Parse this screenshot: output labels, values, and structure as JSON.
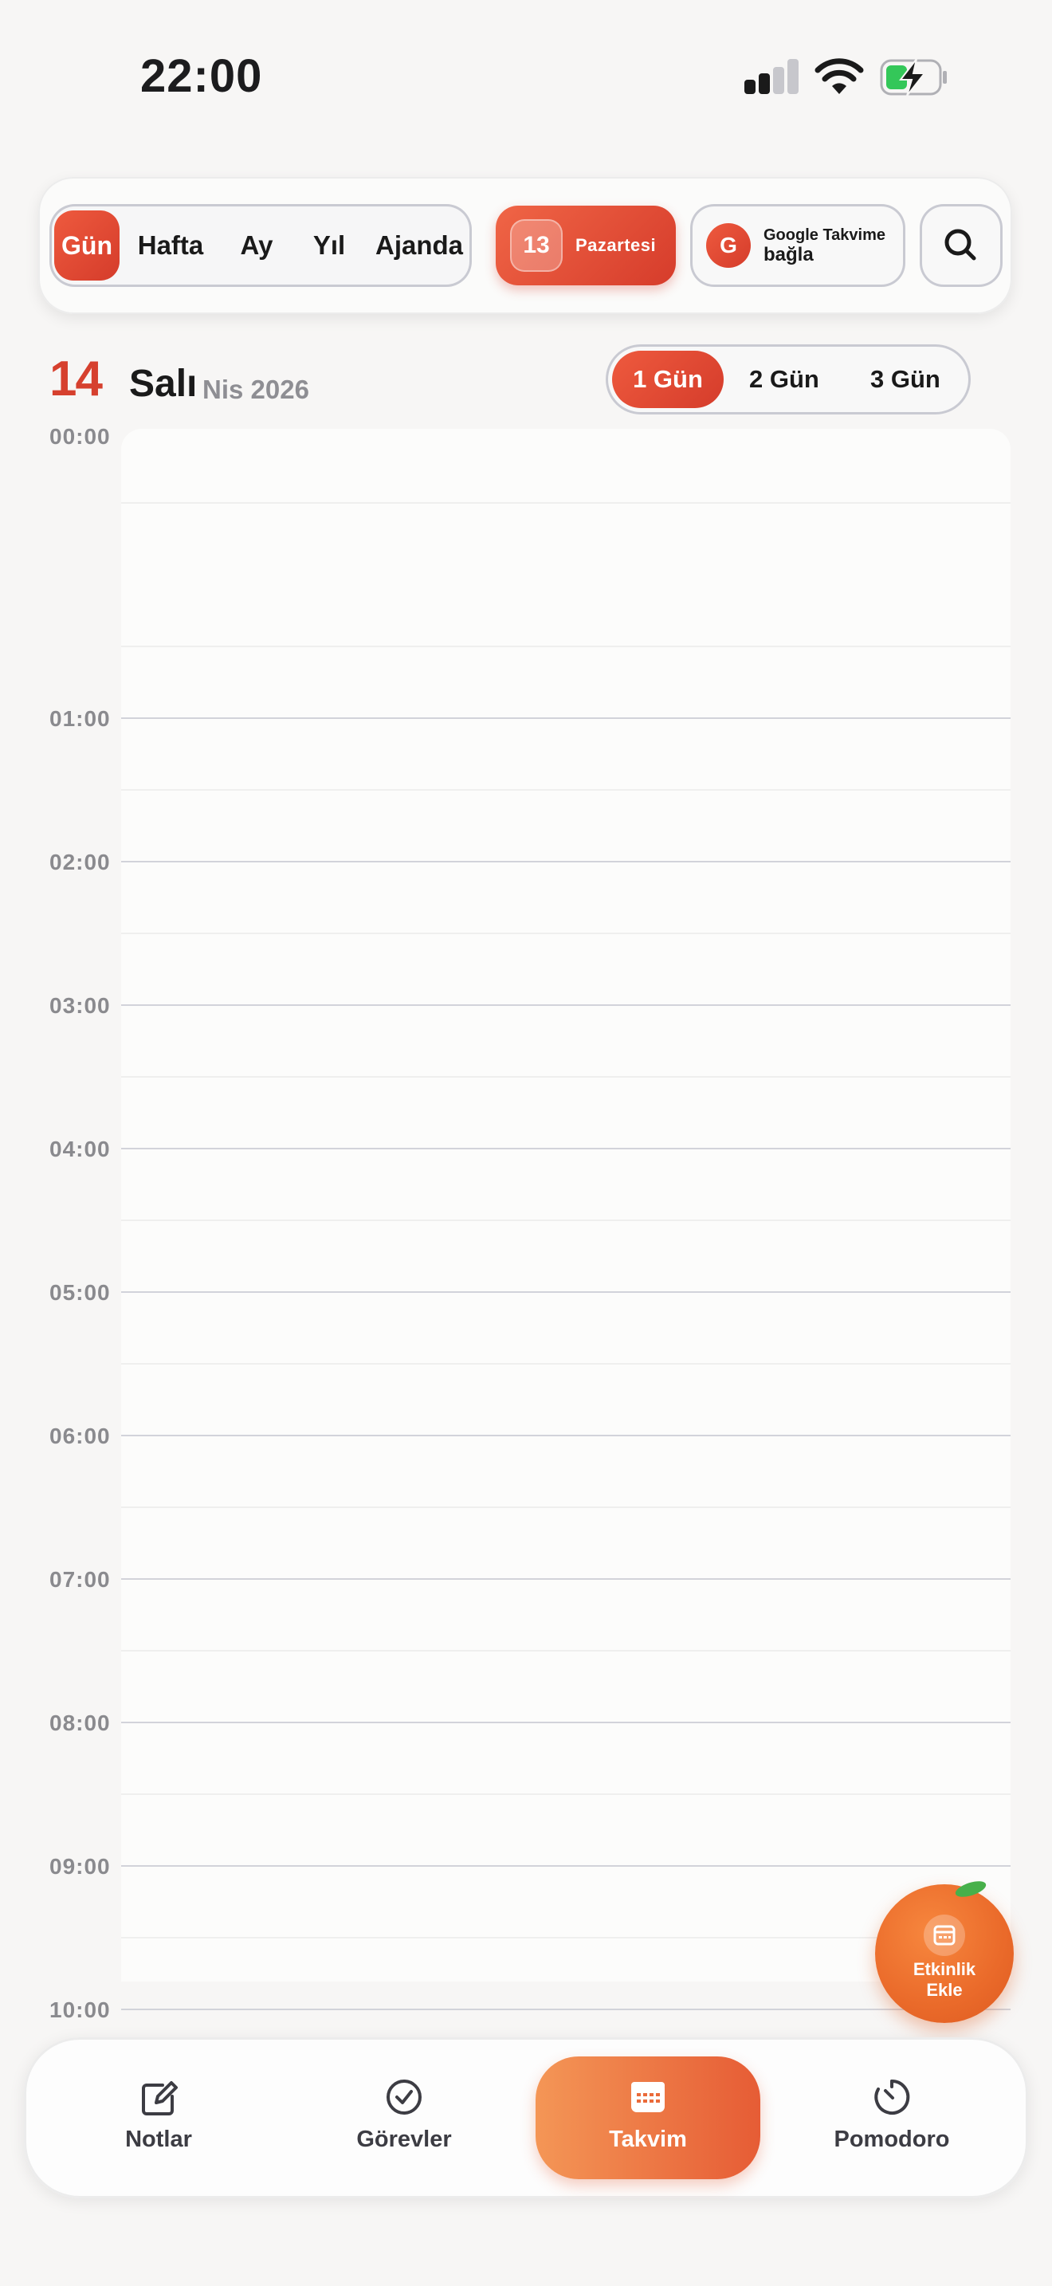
{
  "status_bar": {
    "time": "22:00"
  },
  "view_switcher": {
    "items": [
      "Gün",
      "Hafta",
      "Ay",
      "Yıl",
      "Ajanda"
    ],
    "active": "Gün"
  },
  "today_button": {
    "day_number": "13",
    "day_name": "Pazartesi"
  },
  "google_button": {
    "logo": "G",
    "line1": "Google Takvime",
    "line2": "bağla"
  },
  "date_header": {
    "day_number": "14",
    "day_name": "Salı",
    "month_year": "Nis 2026"
  },
  "day_count_selector": {
    "items": [
      "1 Gün",
      "2 Gün",
      "3 Gün"
    ],
    "active": "1 Gün"
  },
  "timeline": {
    "hours": [
      "00:00",
      "01:00",
      "02:00",
      "03:00",
      "04:00",
      "05:00",
      "06:00",
      "07:00",
      "08:00",
      "09:00",
      "10:00"
    ]
  },
  "fab": {
    "label_line1": "Etkinlik",
    "label_line2": "Ekle"
  },
  "tabbar": {
    "items": [
      {
        "label": "Notlar",
        "icon": "edit-note-icon"
      },
      {
        "label": "Görevler",
        "icon": "check-circle-icon"
      },
      {
        "label": "Takvim",
        "icon": "calendar-icon"
      },
      {
        "label": "Pomodoro",
        "icon": "timer-icon"
      }
    ],
    "active": "Takvim"
  },
  "colors": {
    "accent": "#d6402e",
    "accent_light": "#ee5a3e",
    "tab_active_start": "#f49656",
    "tab_active_end": "#e65c35",
    "fab": "#ea6a2a",
    "hour_line": "#d2d3da"
  }
}
